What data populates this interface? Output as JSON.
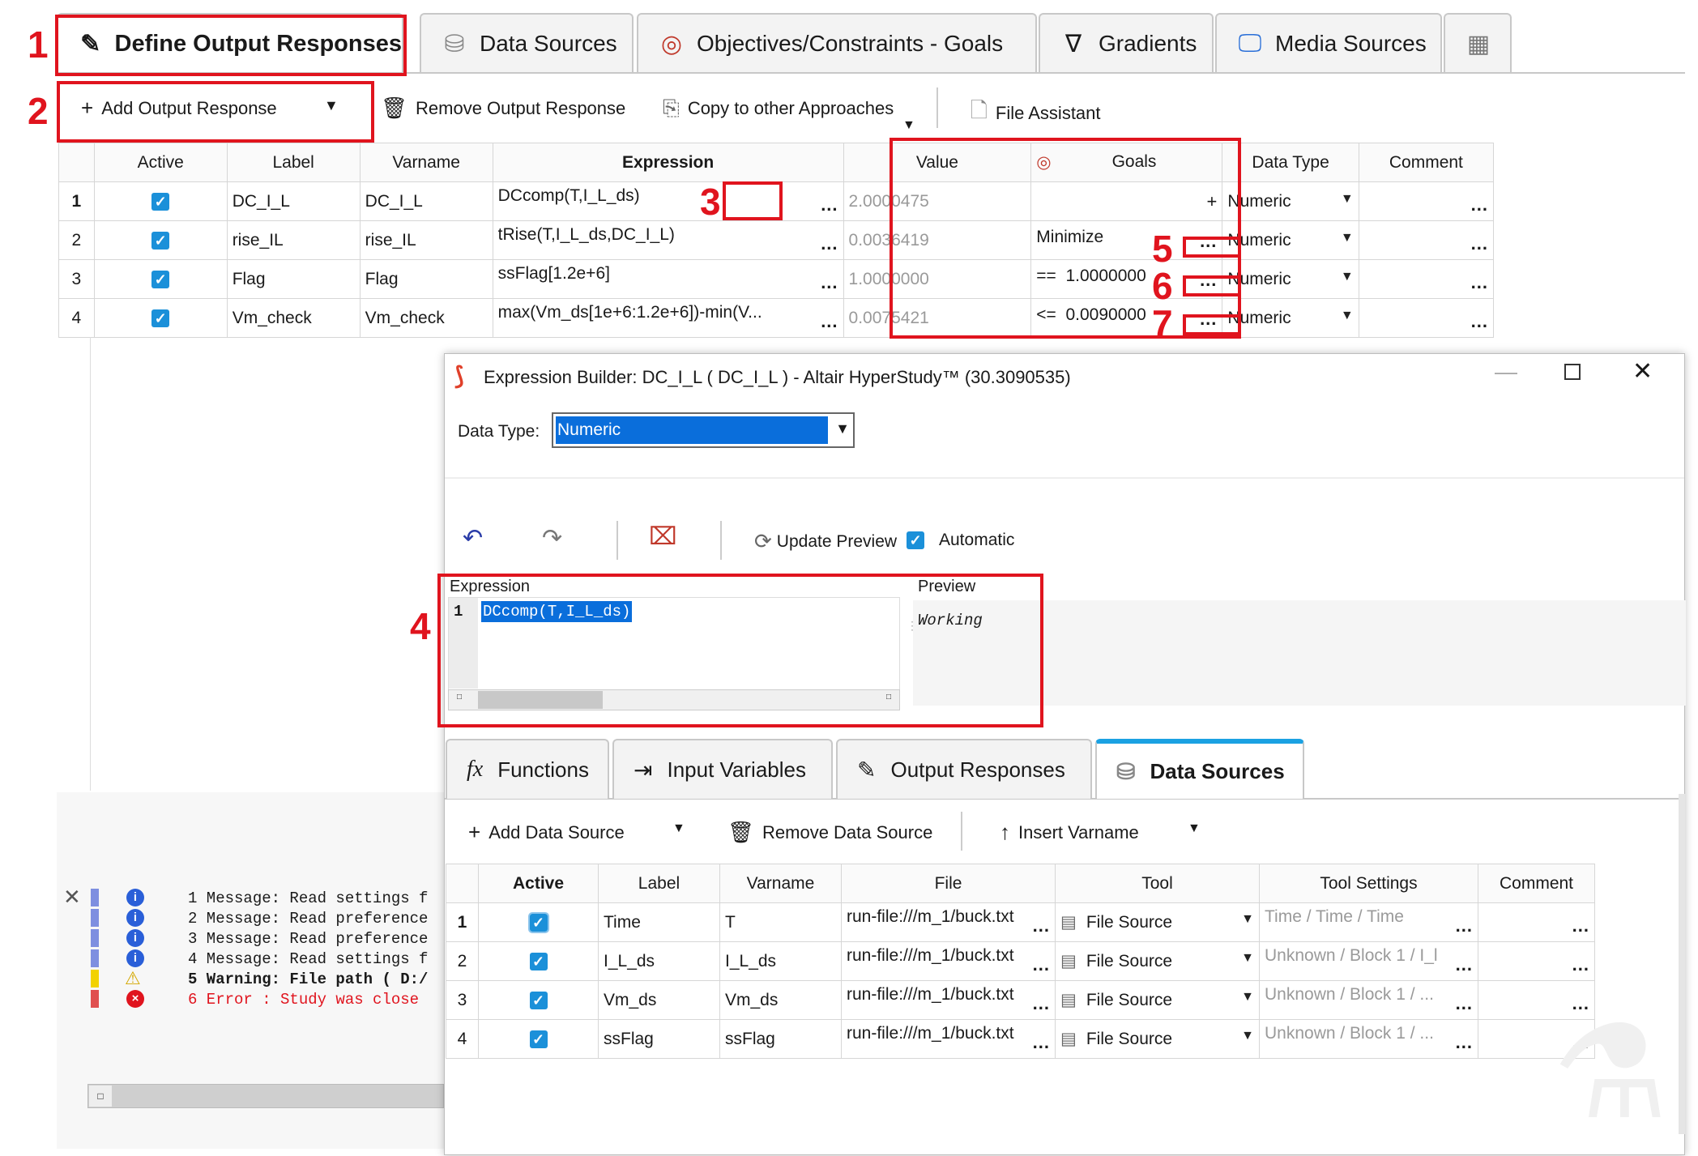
{
  "main_tabs": [
    {
      "label": "Define Output Responses",
      "icon": "output-response-icon"
    },
    {
      "label": "Data Sources",
      "icon": "database-icon"
    },
    {
      "label": "Objectives/Constraints - Goals",
      "icon": "target-icon"
    },
    {
      "label": "Gradients",
      "icon": "nabla-icon"
    },
    {
      "label": "Media Sources",
      "icon": "monitor-icon"
    }
  ],
  "toolbar": {
    "add_output_response": "Add Output Response",
    "remove_output_response": "Remove Output Response",
    "copy_to_other": "Copy to other Approaches",
    "file_assistant": "File Assistant"
  },
  "responses_table": {
    "headers": [
      "Active",
      "Label",
      "Varname",
      "Expression",
      "Value",
      "Goals",
      "Data Type",
      "Comment"
    ],
    "rows": [
      {
        "idx": "1",
        "label": "DC_I_L",
        "varname": "DC_I_L",
        "expression": "DCcomp(T,I_L_ds)",
        "value": "2.0000475",
        "goal": "",
        "goal_plus": "+",
        "datatype": "Numeric"
      },
      {
        "idx": "2",
        "label": "rise_IL",
        "varname": "rise_IL",
        "expression": "tRise(T,I_L_ds,DC_I_L)",
        "value": "0.0036419",
        "goal": "Minimize",
        "goal_plus": "",
        "datatype": "Numeric"
      },
      {
        "idx": "3",
        "label": "Flag",
        "varname": "Flag",
        "expression": "ssFlag[1.2e+6]",
        "value": "1.0000000",
        "goal": "==  1.0000000",
        "goal_plus": "",
        "datatype": "Numeric"
      },
      {
        "idx": "4",
        "label": "Vm_check",
        "varname": "Vm_check",
        "expression": "max(Vm_ds[1e+6:1.2e+6])-min(V...",
        "value": "0.0075421",
        "goal": "<=  0.0090000",
        "goal_plus": "",
        "datatype": "Numeric"
      }
    ]
  },
  "dots": "...",
  "annotations": [
    "1",
    "2",
    "3",
    "4",
    "5",
    "6",
    "7"
  ],
  "builder": {
    "title": "Expression Builder: DC_I_L ( DC_I_L ) - Altair HyperStudy™ (30.3090535)",
    "data_type_label": "Data Type:",
    "data_type_value": "Numeric",
    "update_preview": "Update Preview",
    "automatic": "Automatic",
    "expression_label": "Expression",
    "line_number": "1",
    "expression_text": "DCcomp(T,I_L_ds)",
    "preview_label": "Preview",
    "preview_text": "Working",
    "tabs": [
      {
        "label": "Functions",
        "icon": "fx-icon"
      },
      {
        "label": "Input Variables",
        "icon": "input-variable-icon"
      },
      {
        "label": "Output Responses",
        "icon": "output-response-icon"
      },
      {
        "label": "Data Sources",
        "icon": "database-icon"
      }
    ],
    "ds_toolbar": {
      "add": "Add Data Source",
      "remove": "Remove Data Source",
      "insert": "Insert Varname"
    },
    "ds_table": {
      "headers": [
        "Active",
        "Label",
        "Varname",
        "File",
        "Tool",
        "Tool Settings",
        "Comment"
      ],
      "rows": [
        {
          "idx": "1",
          "label": "Time",
          "varname": "T",
          "file": "run-file:///m_1/buck.txt",
          "tool": "File Source",
          "settings": "Time / Time / Time"
        },
        {
          "idx": "2",
          "label": "I_L_ds",
          "varname": "I_L_ds",
          "file": "run-file:///m_1/buck.txt",
          "tool": "File Source",
          "settings": "Unknown / Block 1 / I_l"
        },
        {
          "idx": "3",
          "label": "Vm_ds",
          "varname": "Vm_ds",
          "file": "run-file:///m_1/buck.txt",
          "tool": "File Source",
          "settings": "Unknown / Block 1 / ..."
        },
        {
          "idx": "4",
          "label": "ssFlag",
          "varname": "ssFlag",
          "file": "run-file:///m_1/buck.txt",
          "tool": "File Source",
          "settings": "Unknown / Block 1 / ..."
        }
      ]
    }
  },
  "log": [
    {
      "text": "1 Message: Read settings f",
      "type": "info"
    },
    {
      "text": "2 Message: Read preference",
      "type": "info"
    },
    {
      "text": "3 Message: Read preference",
      "type": "info"
    },
    {
      "text": "4 Message: Read settings f",
      "type": "info"
    },
    {
      "text": "5 Warning: File path ( D:/",
      "type": "warning"
    },
    {
      "text": "6 Error  : Study was close",
      "type": "error"
    }
  ],
  "colors": {
    "annotation": "#e0141e",
    "accent": "#1b90d9",
    "selection": "#0a6edb",
    "error": "#e0141e"
  }
}
